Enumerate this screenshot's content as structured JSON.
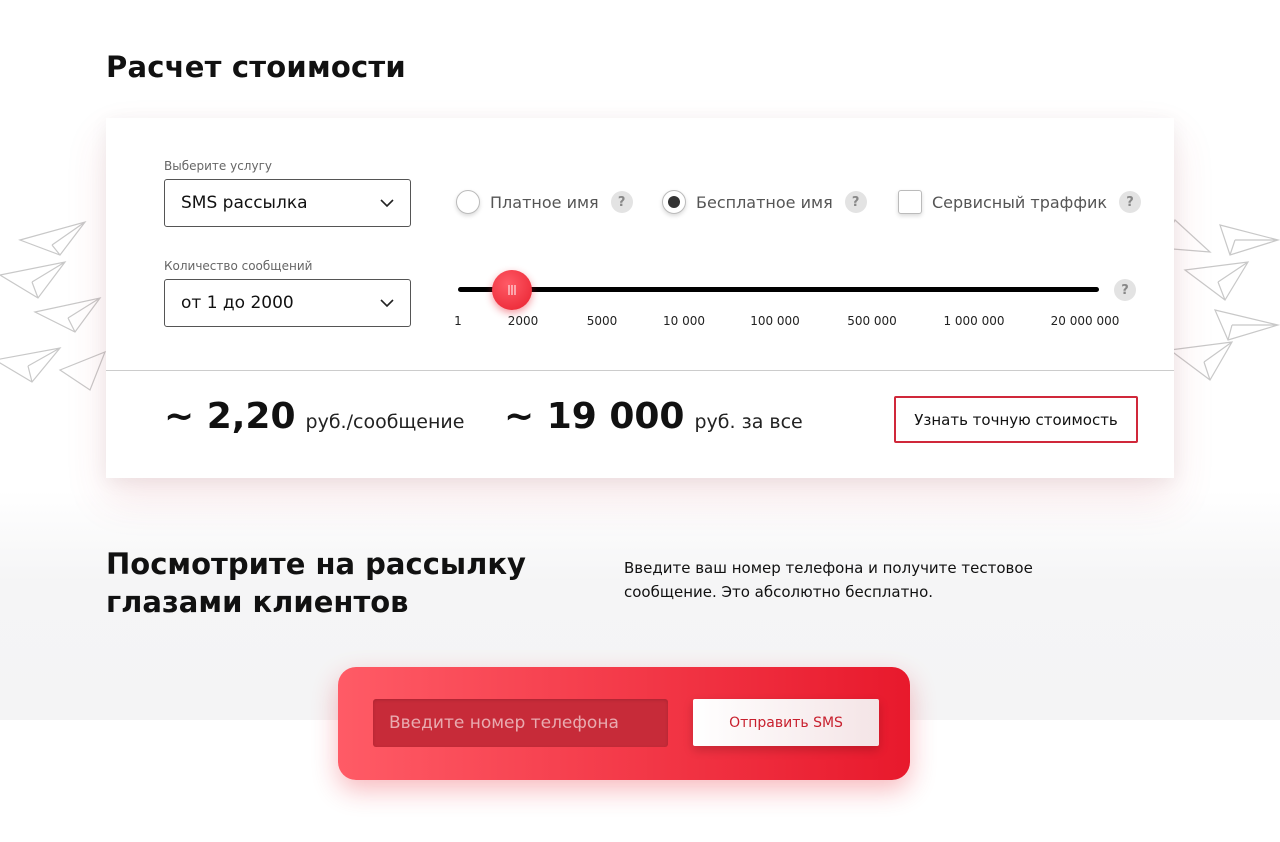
{
  "calculator": {
    "title": "Расчет стоимости",
    "service": {
      "label": "Выберите услугу",
      "value": "SMS рассылка"
    },
    "options": [
      {
        "label": "Платное имя",
        "type": "radio",
        "checked": false
      },
      {
        "label": "Бесплатное имя",
        "type": "radio",
        "checked": true
      },
      {
        "label": "Сервисный траффик",
        "type": "checkbox",
        "checked": false
      }
    ],
    "quantity": {
      "label": "Количество сообщений",
      "value": "от 1 до 2000"
    },
    "slider": {
      "ticks": [
        "1",
        "2000",
        "5000",
        "10 000",
        "100 000",
        "500 000",
        "1 000 000",
        "20 000 000"
      ],
      "selected": "2000"
    },
    "help_symbol": "?",
    "price_per_message": "~ 2,20",
    "price_per_message_unit": "руб./сообщение",
    "price_total": "~ 19 000",
    "price_total_unit": "руб. за все",
    "exact_cost_button": "Узнать точную стоимость"
  },
  "promo": {
    "title": "Посмотрите на рассылку глазами клиентов",
    "text": "Введите ваш номер телефона и получите тестовое сообщение. Это абсолютно бесплатно.",
    "phone_placeholder": "Введите номер телефона",
    "send_button": "Отправить SMS"
  },
  "colors": {
    "accent": "#e8192c",
    "accent_light": "#ff5b66"
  }
}
